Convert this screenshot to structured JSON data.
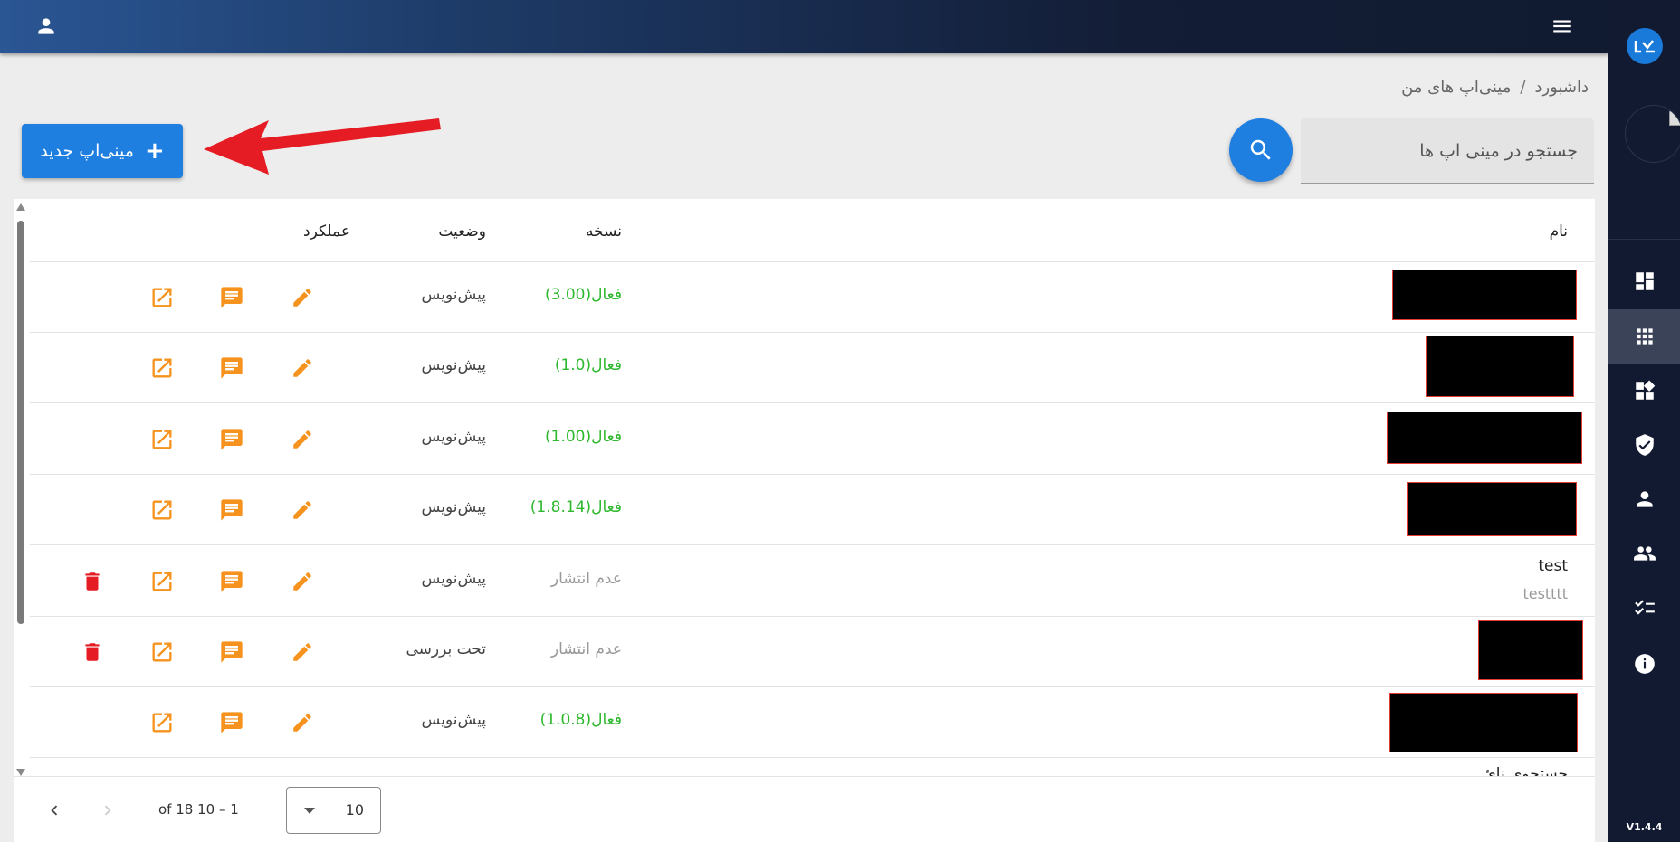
{
  "sidebar": {
    "version": "V1.4.4",
    "items": [
      {
        "icon": "dashboard-icon"
      },
      {
        "icon": "apps-grid-icon",
        "active": true
      },
      {
        "icon": "widgets-icon"
      },
      {
        "icon": "shield-check-icon"
      },
      {
        "icon": "person-icon"
      },
      {
        "icon": "people-icon"
      },
      {
        "icon": "checklist-icon"
      },
      {
        "icon": "info-icon"
      }
    ]
  },
  "breadcrumb": {
    "home": "داشبورد",
    "separator": "/",
    "current": "مینی‌اپ های من"
  },
  "search": {
    "placeholder": "جستجو در مینی اپ ها"
  },
  "new_button": {
    "plus": "+",
    "label": "مینی‌اپ جدید"
  },
  "table": {
    "headers": {
      "name": "نام",
      "version": "نسخه",
      "status": "وضعیت",
      "actions": "عملکرد"
    },
    "rows": [
      {
        "name": "",
        "sub": "",
        "redacted": true,
        "version": "فعال(3.00)",
        "version_state": "active",
        "status": "پیش‌نویس",
        "deletable": false
      },
      {
        "name": "",
        "sub": "",
        "redacted": true,
        "version": "فعال(1.0)",
        "version_state": "active",
        "status": "پیش‌نویس",
        "deletable": false
      },
      {
        "name": "",
        "sub": "",
        "redacted": true,
        "version": "فعال(1.00)",
        "version_state": "active",
        "status": "پیش‌نویس",
        "deletable": false
      },
      {
        "name": "",
        "sub": "",
        "redacted": true,
        "version": "فعال(1.8.14)",
        "version_state": "active",
        "status": "پیش‌نویس",
        "deletable": false
      },
      {
        "name": "test",
        "sub": "testttt",
        "redacted": false,
        "version": "عدم انتشار",
        "version_state": "unpublished",
        "status": "پیش‌نویس",
        "deletable": true
      },
      {
        "name": "",
        "sub": "",
        "redacted": true,
        "version": "عدم انتشار",
        "version_state": "unpublished",
        "status": "تحت بررسی",
        "deletable": true
      },
      {
        "name": "",
        "sub": "",
        "redacted": true,
        "version": "فعال(1.0.8)",
        "version_state": "active",
        "status": "پیش‌نویس",
        "deletable": false
      }
    ],
    "partial_row_text": "جستجوی نائ"
  },
  "pagination": {
    "range": "1 – 10 of 18",
    "page_size": "10"
  },
  "colors": {
    "primary": "#1e7fe0",
    "active_version": "#2db82d",
    "action_orange": "#f6931e",
    "delete_red": "#e51c23",
    "sidebar_bg": "#111a30"
  }
}
